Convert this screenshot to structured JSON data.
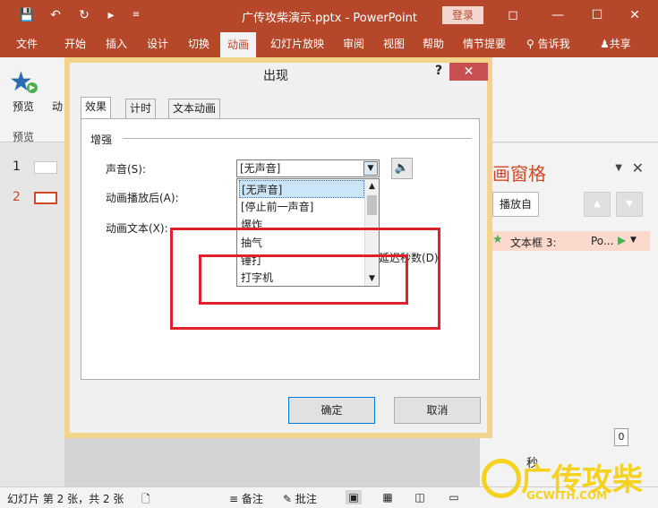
{
  "titlebar": {
    "doc_title": "广传攻柴演示.pptx - PowerPoint",
    "login_label": "登录"
  },
  "tabs": [
    {
      "label": "文件"
    },
    {
      "label": "开始"
    },
    {
      "label": "插入"
    },
    {
      "label": "设计"
    },
    {
      "label": "切换"
    },
    {
      "label": "动画"
    },
    {
      "label": "幻灯片放映"
    },
    {
      "label": "审阅"
    },
    {
      "label": "视图"
    },
    {
      "label": "帮助"
    },
    {
      "label": "情节提要"
    },
    {
      "label": "告诉我"
    },
    {
      "label": "共享"
    }
  ],
  "ribbon": {
    "preview_label": "预览",
    "preview_group": "预览",
    "anim_trunc": "动"
  },
  "slides": [
    {
      "num": "1"
    },
    {
      "num": "2"
    }
  ],
  "anim_pane": {
    "title": "画窗格",
    "play_from": "播放自",
    "item_label": "文本框 3:",
    "item_po": "Po...",
    "secs": "秒",
    "secs_value": "0"
  },
  "statusbar": {
    "slide_info": "幻灯片 第 2 张，共 2 张",
    "notes": "备注",
    "comments": "批注"
  },
  "dialog": {
    "title": "出现",
    "tabs": [
      {
        "label": "效果"
      },
      {
        "label": "计时"
      },
      {
        "label": "文本动画"
      }
    ],
    "group_label": "增强",
    "sound_label": "声音(S):",
    "after_label": "动画播放后(A):",
    "text_label": "动画文本(X):",
    "sound_value": "[无声音]",
    "dimmed_option": "延迟秒数(D)",
    "sound_options": [
      "[无声音]",
      "[停止前一声音]",
      "爆炸",
      "抽气",
      "锤打",
      "打字机"
    ],
    "ok": "确定",
    "cancel": "取消"
  },
  "watermark": {
    "text": "广传攻柴",
    "sub": "GCWITH.COM"
  },
  "colors": {
    "accent": "#b7472a",
    "highlight": "#e0212b"
  }
}
